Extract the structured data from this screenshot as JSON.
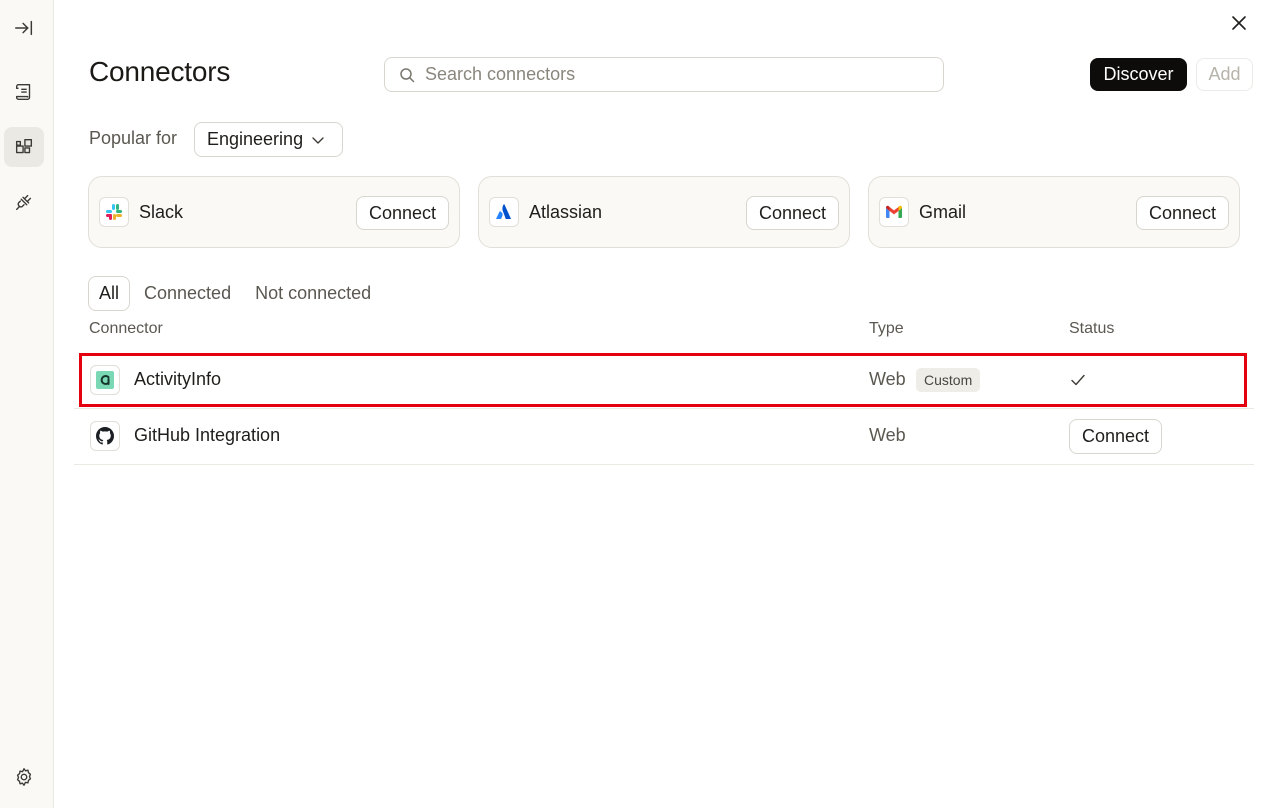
{
  "sidebar": {
    "items": [
      {
        "icon": "collapse-sidebar-icon"
      },
      {
        "icon": "scroll-icon"
      },
      {
        "icon": "connectors-icon",
        "active": true
      },
      {
        "icon": "plug-icon"
      }
    ],
    "footer_icon": "gear-icon"
  },
  "header": {
    "title": "Connectors",
    "search_placeholder": "Search connectors",
    "discover_label": "Discover",
    "add_label": "Add"
  },
  "popular": {
    "label": "Popular for",
    "selected": "Engineering",
    "cards": [
      {
        "name": "Slack",
        "icon": "slack-logo-icon",
        "button": "Connect"
      },
      {
        "name": "Atlassian",
        "icon": "atlassian-logo-icon",
        "button": "Connect"
      },
      {
        "name": "Gmail",
        "icon": "gmail-logo-icon",
        "button": "Connect"
      }
    ]
  },
  "tabs": [
    {
      "label": "All",
      "active": true
    },
    {
      "label": "Connected"
    },
    {
      "label": "Not connected"
    }
  ],
  "table": {
    "columns": [
      "Connector",
      "Type",
      "Status"
    ],
    "rows": [
      {
        "name": "ActivityInfo",
        "icon": "activityinfo-logo-icon",
        "type": "Web",
        "badge": "Custom",
        "status": "connected",
        "highlighted": true
      },
      {
        "name": "GitHub Integration",
        "icon": "github-logo-icon",
        "type": "Web",
        "status_button": "Connect"
      }
    ]
  },
  "colors": {
    "highlight": "#e5000f",
    "primary_button": "#0d0c0a",
    "sidebar_bg": "#faf9f6"
  }
}
